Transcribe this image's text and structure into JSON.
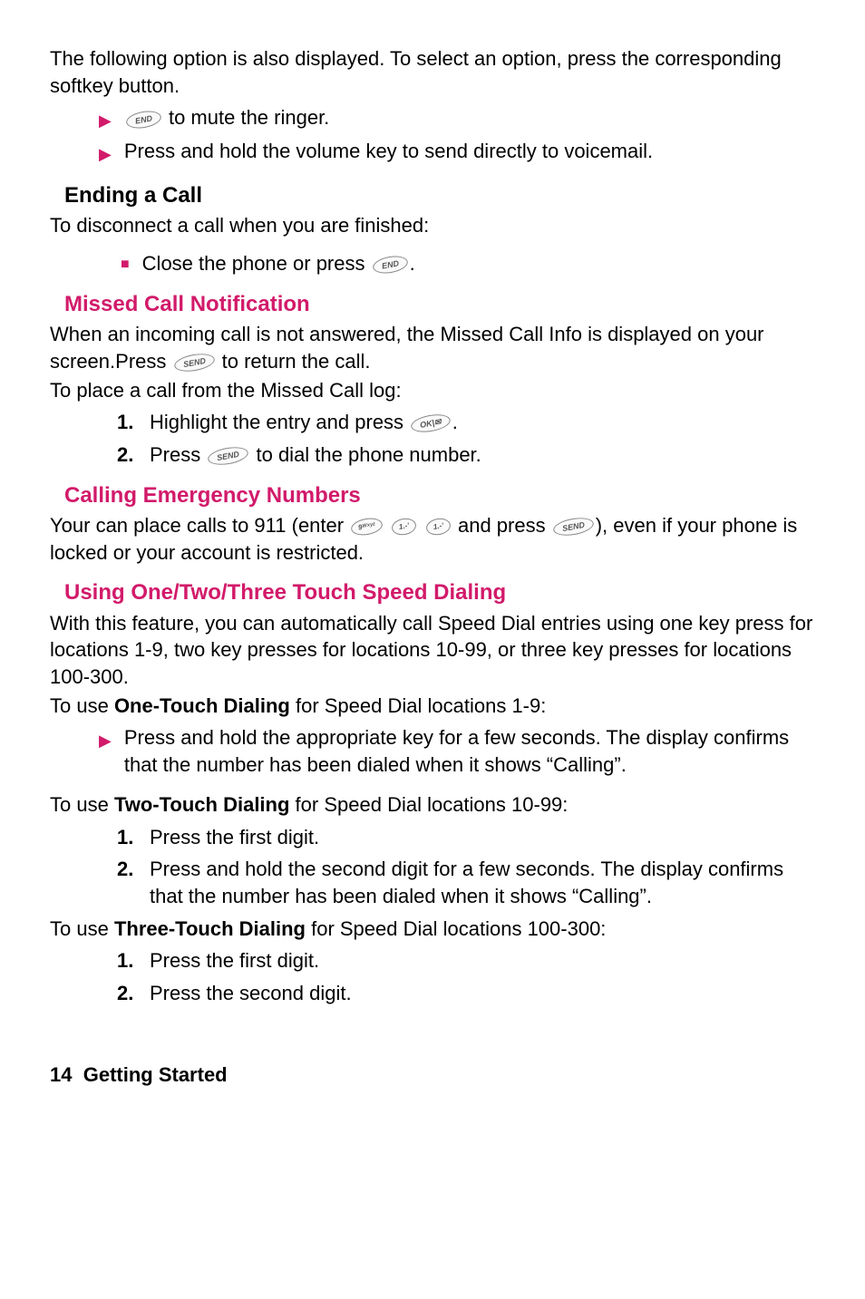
{
  "intro": "The following option is also displayed. To select an option, press the corresponding softkey button.",
  "introBullets": {
    "mute_pre": "",
    "mute_post": " to mute the ringer.",
    "voicemail": "Press and hold the volume key to send directly to voicemail."
  },
  "endingCall": {
    "title": "Ending a Call",
    "intro": "To disconnect a call when you are finished:",
    "item_pre": "Close the phone or press ",
    "item_post": "."
  },
  "missedCall": {
    "title": "Missed Call Notification",
    "p1_pre": "When an incoming call is not answered, the Missed Call Info is displayed on your screen.Press ",
    "p1_post": " to return the call.",
    "p2": "To place a call from the Missed Call log:",
    "step1_pre": "Highlight the entry and press ",
    "step1_post": ".",
    "step2_pre": "Press ",
    "step2_post": " to dial the phone number."
  },
  "emergency": {
    "title": "Calling Emergency Numbers",
    "p_pre": "Your can place calls to 911 (enter ",
    "p_mid": " and press ",
    "p_post": "), even if your phone is locked or your account is restricted."
  },
  "speedDial": {
    "title": "Using One/Two/Three Touch Speed Dialing",
    "intro": "With this feature, you can automatically call Speed Dial entries using one key press for locations 1-9, two key presses for locations 10-99, or three key presses for locations 100-300.",
    "one_pre": "To use ",
    "one_bold": "One-Touch Dialing",
    "one_post": " for Speed Dial locations 1-9:",
    "one_bullet": "Press and hold the appropriate key for a few seconds. The display confirms that the number has been dialed when it shows “Calling”.",
    "two_pre": "To use ",
    "two_bold": "Two-Touch Dialing",
    "two_post": " for Speed Dial locations 10-99:",
    "two_step1": "Press the first digit.",
    "two_step2": "Press and hold the second digit for a few seconds. The display confirms that the number has been dialed when it shows “Calling”.",
    "three_pre": "To use ",
    "three_bold": "Three-Touch Dialing",
    "three_post": " for Speed Dial locations 100-300:",
    "three_step1": "Press the first digit.",
    "three_step2": "Press the second digit."
  },
  "keys": {
    "end": "END",
    "send": "SEND",
    "ok": "OK|✉",
    "nine": "9ᵂˣʸᶻ",
    "one": "1.-'"
  },
  "footer": {
    "page": "14",
    "section": "Getting Started"
  }
}
